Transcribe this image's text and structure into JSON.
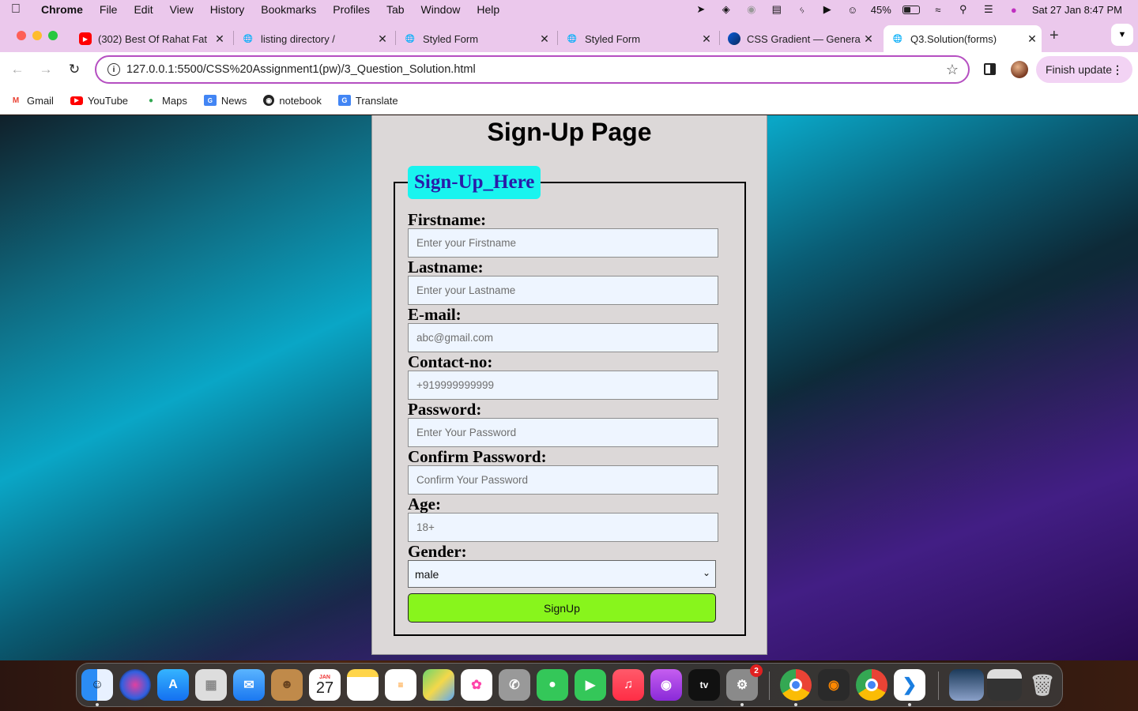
{
  "menubar": {
    "items": [
      "Chrome",
      "File",
      "Edit",
      "View",
      "History",
      "Bookmarks",
      "Profiles",
      "Tab",
      "Window",
      "Help"
    ],
    "battery_percent": "45%",
    "battery_level": 0.45,
    "datetime": "Sat 27 Jan  8:47 PM"
  },
  "tabs": [
    {
      "title": "(302) Best Of Rahat Fat",
      "icon": "youtube-icon",
      "active": false
    },
    {
      "title": "listing directory /",
      "icon": "globe-icon",
      "active": false
    },
    {
      "title": "Styled Form",
      "icon": "globe-icon",
      "active": false
    },
    {
      "title": "Styled Form",
      "icon": "globe-icon",
      "active": false
    },
    {
      "title": "CSS Gradient — Genera",
      "icon": "cssgradient-icon",
      "active": false
    },
    {
      "title": "Q3.Solution(forms)",
      "icon": "globe-icon",
      "active": true
    }
  ],
  "toolbar": {
    "url": "127.0.0.1:5500/CSS%20Assignment1(pw)/3_Question_Solution.html",
    "finish_update": "Finish update"
  },
  "bookmarks": [
    "Gmail",
    "YouTube",
    "Maps",
    "News",
    "notebook",
    "Translate"
  ],
  "page": {
    "title": "Sign-Up Page",
    "legend": "Sign-Up_Here",
    "fields": [
      {
        "label": "Firstname:",
        "placeholder": "Enter your Firstname"
      },
      {
        "label": "Lastname:",
        "placeholder": "Enter your Lastname"
      },
      {
        "label": "E-mail:",
        "placeholder": "abc@gmail.com"
      },
      {
        "label": "Contact-no:",
        "placeholder": "+919999999999"
      },
      {
        "label": "Password:",
        "placeholder": "Enter Your Password"
      },
      {
        "label": "Confirm Password:",
        "placeholder": "Confirm Your Password"
      },
      {
        "label": "Age:",
        "placeholder": "18+"
      }
    ],
    "gender_label": "Gender:",
    "gender_value": "male",
    "submit_label": "SignUp"
  },
  "dock": {
    "calendar_month": "JAN",
    "calendar_day": "27",
    "settings_badge": "2"
  },
  "colors": {
    "chrome_frame": "#ebc8ec",
    "legend_bg": "#19f4ef",
    "legend_text": "#2a1ba8",
    "submit_bg": "#88f51c",
    "panel_bg": "#dcd8d8",
    "input_bg": "#eef5ff"
  }
}
